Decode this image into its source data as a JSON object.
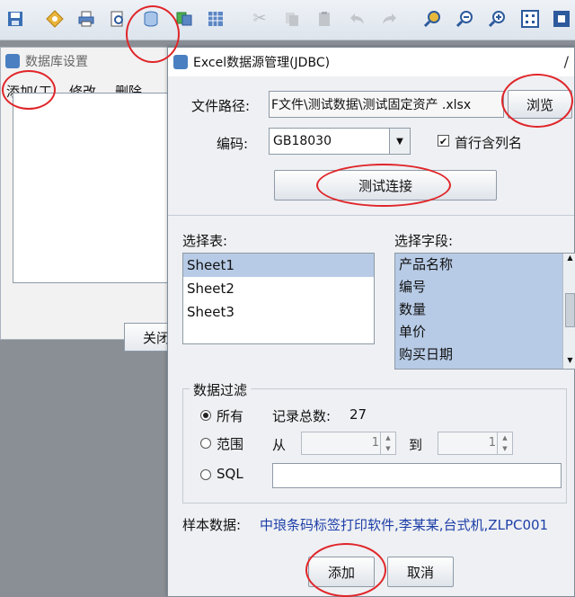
{
  "toolbar": {
    "icons": [
      "save-icon",
      "settings-icon",
      "print-icon",
      "print-preview-icon",
      "database-icon",
      "layers-icon",
      "table-icon",
      "cut-icon",
      "copy-icon",
      "paste-icon",
      "undo-icon",
      "redo-icon",
      "zoom-fit-icon",
      "zoom-in-icon",
      "zoom-out-icon",
      "grid-icon",
      "select-icon"
    ]
  },
  "db_window": {
    "title": "数据库设置",
    "menu": [
      "添加(工",
      "修改",
      "删除"
    ],
    "close_label": "关闭"
  },
  "dialog": {
    "title": "Excel数据源管理(JDBC)",
    "close_glyph": "/",
    "file_path_label": "文件路径:",
    "file_path_value": "F文件\\测试数据\\测试固定资产 .xlsx",
    "browse_label": "浏览",
    "encoding_label": "编码:",
    "encoding_value": "GB18030",
    "first_row_label": "首行含列名",
    "test_connection_label": "测试连接",
    "select_table_label": "选择表:",
    "tables": [
      "Sheet1",
      "Sheet2",
      "Sheet3"
    ],
    "select_field_label": "选择字段:",
    "fields": [
      "产品名称",
      "编号",
      "数量",
      "单价",
      "购买日期"
    ],
    "filter_title": "数据过滤",
    "radio_all": "所有",
    "record_total_label": "记录总数:",
    "record_total_value": "27",
    "radio_range": "范围",
    "from_label": "从",
    "from_value": "1",
    "to_label": "到",
    "to_value": "1",
    "radio_sql": "SQL",
    "sample_label": "样本数据:",
    "sample_value": "中琅条码标签打印软件,李某某,台式机,ZLPC001",
    "add_label": "添加",
    "cancel_label": "取消"
  },
  "colors": {
    "annotation": "#e0262a",
    "sample_text": "#1f3fa8",
    "selection": "#b7cbe6"
  }
}
